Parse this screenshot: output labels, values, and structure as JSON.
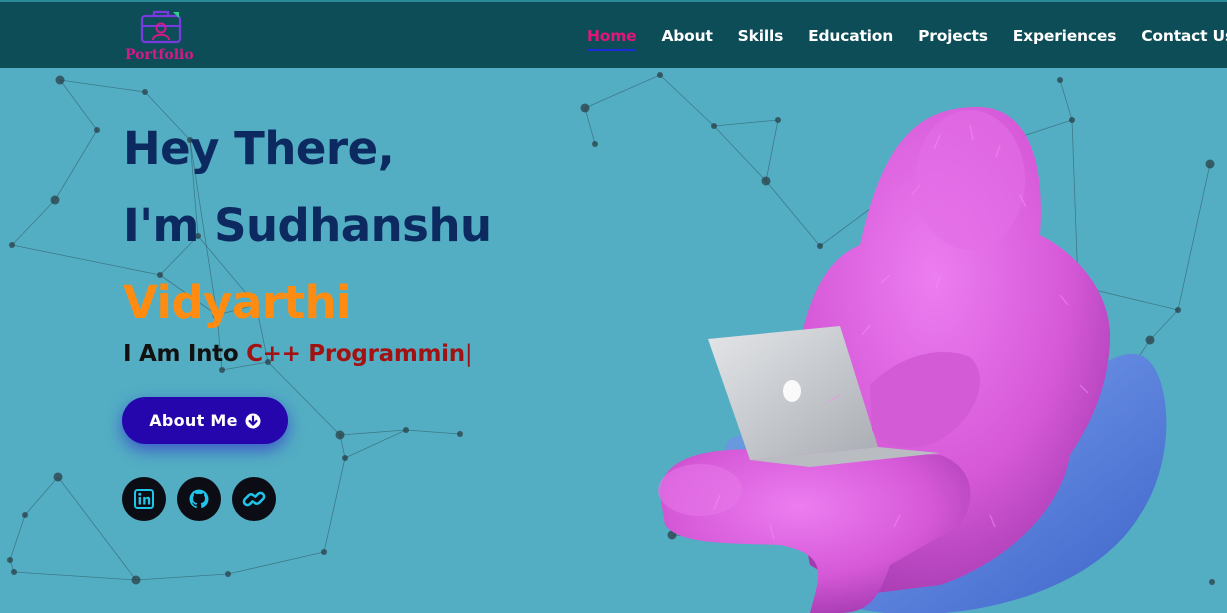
{
  "brand": {
    "logo_text": "Portfolio",
    "logo_icon": "briefcase-user-icon",
    "header_bg": "#0d4d57",
    "logo_color": "#d4198a"
  },
  "nav": {
    "items": [
      {
        "label": "Home",
        "active": true
      },
      {
        "label": "About",
        "active": false
      },
      {
        "label": "Skills",
        "active": false
      },
      {
        "label": "Education",
        "active": false
      },
      {
        "label": "Projects",
        "active": false
      },
      {
        "label": "Experiences",
        "active": false
      },
      {
        "label": "Contact Us",
        "active": false
      }
    ],
    "active_color": "#e3147b"
  },
  "hero": {
    "greeting": "Hey There,",
    "intro": "I'm Sudhanshu",
    "name": "Vidyarthi",
    "typed_prefix": "I Am Into ",
    "typed_word": "C++ Programmin",
    "typed_cursor": "|",
    "button_label": "About Me",
    "button_icon": "arrow-circle-down-icon",
    "background": "#53aec3",
    "title_color": "#0c2a60",
    "name_color": "#ff8c10",
    "button_color": "#2506ad"
  },
  "socials": [
    {
      "name": "linkedin-icon"
    },
    {
      "name": "github-icon"
    },
    {
      "name": "link-icon"
    }
  ],
  "illustration": {
    "subject": "pink-furry-character-with-laptop",
    "fur_color": "#d95bd8",
    "chair_color": "#5f87e0",
    "laptop_color": "#c8cbcf"
  }
}
